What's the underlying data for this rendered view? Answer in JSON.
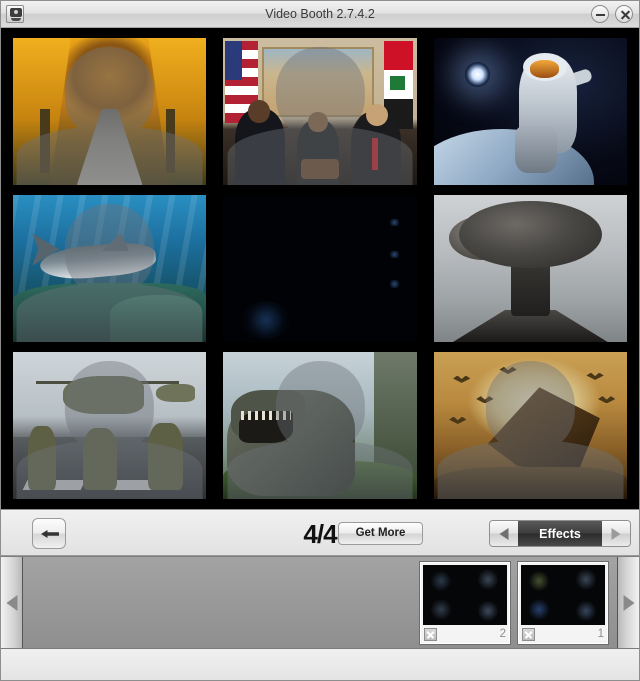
{
  "window": {
    "title": "Video Booth  2.7.4.2",
    "app_icon": "webcam-icon",
    "minimize_label": "–",
    "close_label": "×"
  },
  "toolbar": {
    "back_label": "back-arrow-icon",
    "page_indicator": "4/4",
    "get_more_label": "Get More",
    "category_label": "Effects",
    "prev_arrow": "◀",
    "next_arrow": "▶"
  },
  "effects_grid": {
    "columns": 3,
    "rows": 3,
    "items": [
      {
        "id": "autumn-road",
        "name": "Autumn Road",
        "scene_class": "sc-autumn",
        "has_silhouette": true
      },
      {
        "id": "meeting",
        "name": "Diplomatic Meeting",
        "scene_class": "sc-meeting",
        "has_silhouette": true
      },
      {
        "id": "astronaut",
        "name": "Astronaut In Space",
        "scene_class": "sc-space",
        "has_silhouette": false
      },
      {
        "id": "shark-reef",
        "name": "Shark Reef",
        "scene_class": "sc-reef",
        "has_silhouette": true
      },
      {
        "id": "dark-scene",
        "name": "Dark Scene",
        "scene_class": "sc-dark",
        "has_silhouette": false
      },
      {
        "id": "mushroom",
        "name": "Mushroom Cloud",
        "scene_class": "sc-blast",
        "has_silhouette": false
      },
      {
        "id": "soldiers",
        "name": "Soldiers On Deck",
        "scene_class": "sc-mil",
        "has_silhouette": true
      },
      {
        "id": "t-rex",
        "name": "T-Rex Jungle",
        "scene_class": "sc-dino",
        "has_silhouette": true
      },
      {
        "id": "dragons",
        "name": "Dragons Sky",
        "scene_class": "sc-dragon",
        "has_silhouette": true
      }
    ]
  },
  "filmstrip": {
    "scroll_left": "◀",
    "scroll_right": "▶",
    "thumbnails": [
      {
        "number": "2",
        "delete_label": "delete-icon"
      },
      {
        "number": "1",
        "delete_label": "delete-icon"
      }
    ]
  },
  "colors": {
    "titlebar": "#e2e2e2",
    "canvas": "#000000",
    "toolbar": "#e8e8e8",
    "strip": "#9a9a9a",
    "effects_panel": "#3c3c3c"
  }
}
